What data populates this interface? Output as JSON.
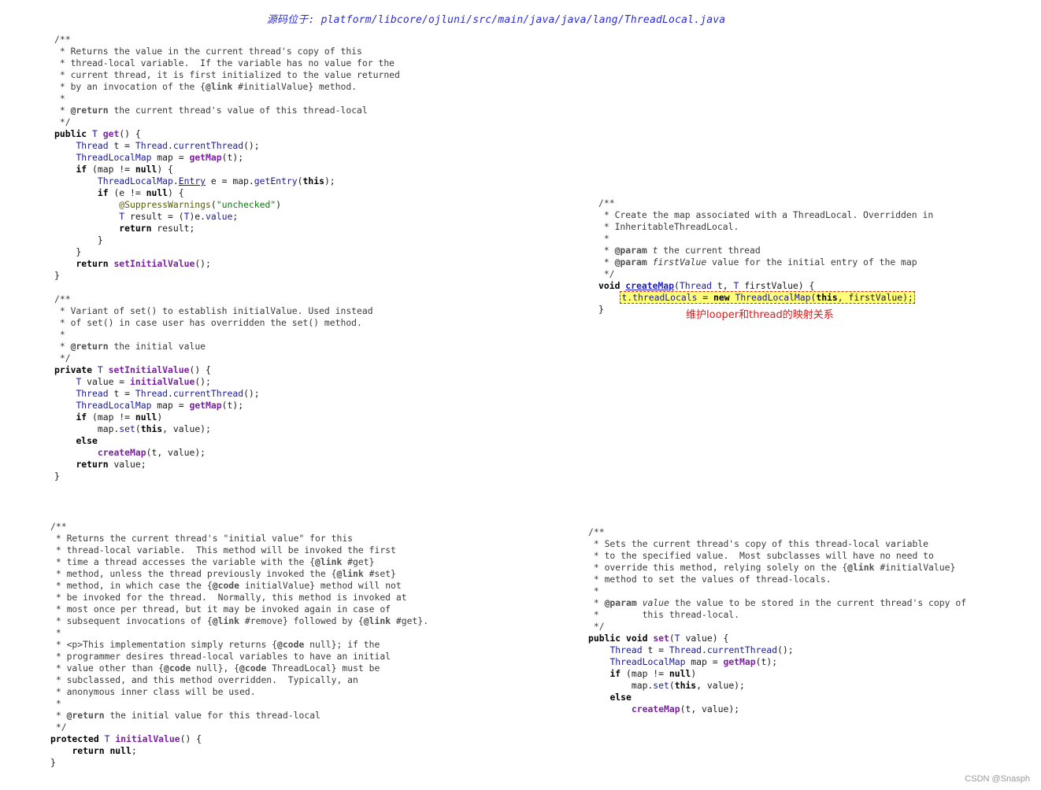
{
  "header": {
    "source_path": "源码位于:  platform/libcore/ojluni/src/main/java/java/lang/ThreadLocal.java"
  },
  "blocks": {
    "get": [
      "/**",
      " * Returns the value in the current thread's copy of this",
      " * thread-local variable.  If the variable has no value for the",
      " * current thread, it is first initialized to the value returned",
      " * by an invocation of the {@link #initialValue} method.",
      " *",
      " * @return the current thread's value of this thread-local",
      " */",
      "public T get() {",
      "    Thread t = Thread.currentThread();",
      "    ThreadLocalMap map = getMap(t);",
      "    if (map != null) {",
      "        ThreadLocalMap.Entry e = map.getEntry(this);",
      "        if (e != null) {",
      "            @SuppressWarnings(\"unchecked\")",
      "            T result = (T)e.value;",
      "            return result;",
      "        }",
      "    }",
      "    return setInitialValue();",
      "}"
    ],
    "set_initial_value": [
      "/**",
      " * Variant of set() to establish initialValue. Used instead",
      " * of set() in case user has overridden the set() method.",
      " *",
      " * @return the initial value",
      " */",
      "private T setInitialValue() {",
      "    T value = initialValue();",
      "    Thread t = Thread.currentThread();",
      "    ThreadLocalMap map = getMap(t);",
      "    if (map != null)",
      "        map.set(this, value);",
      "    else",
      "        createMap(t, value);",
      "    return value;",
      "}"
    ],
    "create_map": [
      "/**",
      " * Create the map associated with a ThreadLocal. Overridden in",
      " * InheritableThreadLocal.",
      " *",
      " * @param t the current thread",
      " * @param firstValue value for the initial entry of the map",
      " */",
      "void createMap(Thread t, T firstValue) {",
      "    t.threadLocals = new ThreadLocalMap(this, firstValue);",
      "}"
    ],
    "initial_value": [
      "/**",
      " * Returns the current thread's \"initial value\" for this",
      " * thread-local variable.  This method will be invoked the first",
      " * time a thread accesses the variable with the {@link #get}",
      " * method, unless the thread previously invoked the {@link #set}",
      " * method, in which case the {@code initialValue} method will not",
      " * be invoked for the thread.  Normally, this method is invoked at",
      " * most once per thread, but it may be invoked again in case of",
      " * subsequent invocations of {@link #remove} followed by {@link #get}.",
      " *",
      " * <p>This implementation simply returns {@code null}; if the",
      " * programmer desires thread-local variables to have an initial",
      " * value other than {@code null}, {@code ThreadLocal} must be",
      " * subclassed, and this method overridden.  Typically, an",
      " * anonymous inner class will be used.",
      " *",
      " * @return the initial value for this thread-local",
      " */",
      "protected T initialValue() {",
      "    return null;",
      "}"
    ],
    "set": [
      "/**",
      " * Sets the current thread's copy of this thread-local variable",
      " * to the specified value.  Most subclasses will have no need to",
      " * override this method, relying solely on the {@link #initialValue}",
      " * method to set the values of thread-locals.",
      " *",
      " * @param value the value to be stored in the current thread's copy of",
      " *        this thread-local.",
      " */",
      "public void set(T value) {",
      "    Thread t = Thread.currentThread();",
      "    ThreadLocalMap map = getMap(t);",
      "    if (map != null)",
      "        map.set(this, value);",
      "    else",
      "        createMap(t, value);",
      "}"
    ]
  },
  "annotation": {
    "note": "维护looper和thread的映射关系"
  },
  "watermark": "CSDN @Snasph",
  "colors": {
    "path_blue": "#2a2ad8",
    "note_red": "#e01818",
    "highlight_yellow": "#ffff78",
    "method_purple": "#7a1fa2",
    "string_green": "#0b7a0b"
  }
}
